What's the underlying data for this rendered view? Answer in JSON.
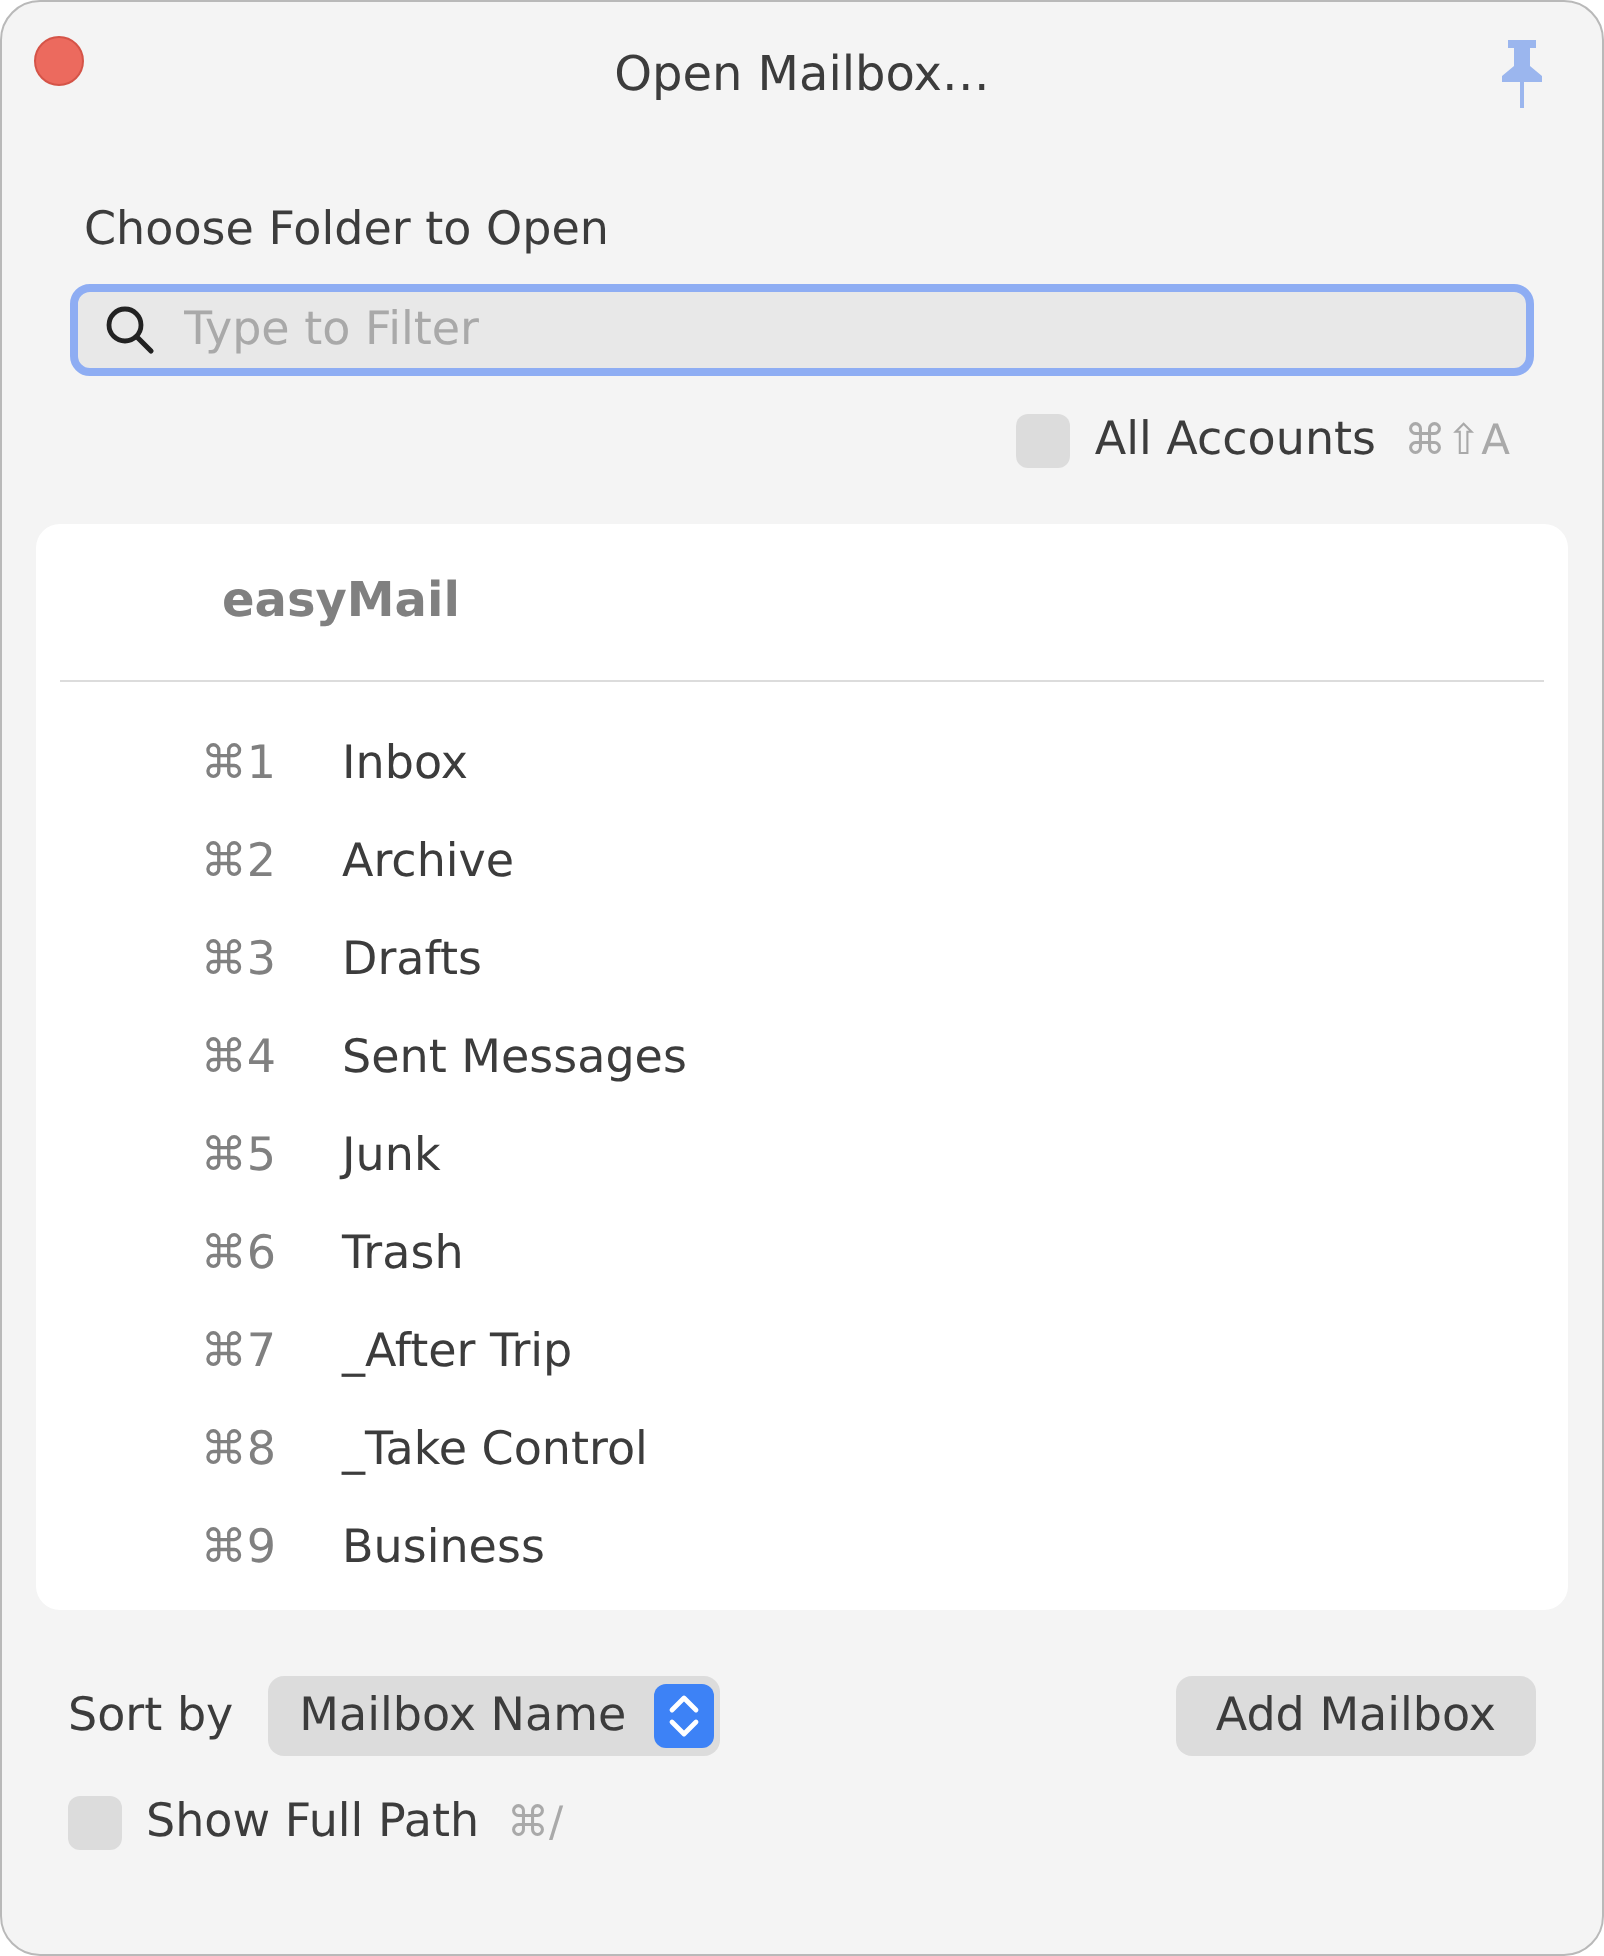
{
  "window": {
    "title": "Open Mailbox…"
  },
  "prompt": "Choose Folder to Open",
  "search": {
    "placeholder": "Type to Filter",
    "focused": true
  },
  "all_accounts": {
    "label": "All Accounts",
    "shortcut": "⌘⇧A",
    "checked": false
  },
  "account": "easyMail",
  "mailboxes": [
    {
      "shortcut": "⌘1",
      "name": "Inbox"
    },
    {
      "shortcut": "⌘2",
      "name": "Archive"
    },
    {
      "shortcut": "⌘3",
      "name": "Drafts"
    },
    {
      "shortcut": "⌘4",
      "name": "Sent Messages"
    },
    {
      "shortcut": "⌘5",
      "name": "Junk"
    },
    {
      "shortcut": "⌘6",
      "name": "Trash"
    },
    {
      "shortcut": "⌘7",
      "name": "_After Trip"
    },
    {
      "shortcut": "⌘8",
      "name": "_Take Control"
    },
    {
      "shortcut": "⌘9",
      "name": "Business"
    }
  ],
  "sort": {
    "label": "Sort by",
    "value": "Mailbox Name"
  },
  "add_button": "Add Mailbox",
  "show_full_path": {
    "label": "Show Full Path",
    "shortcut": "⌘/",
    "checked": false
  }
}
